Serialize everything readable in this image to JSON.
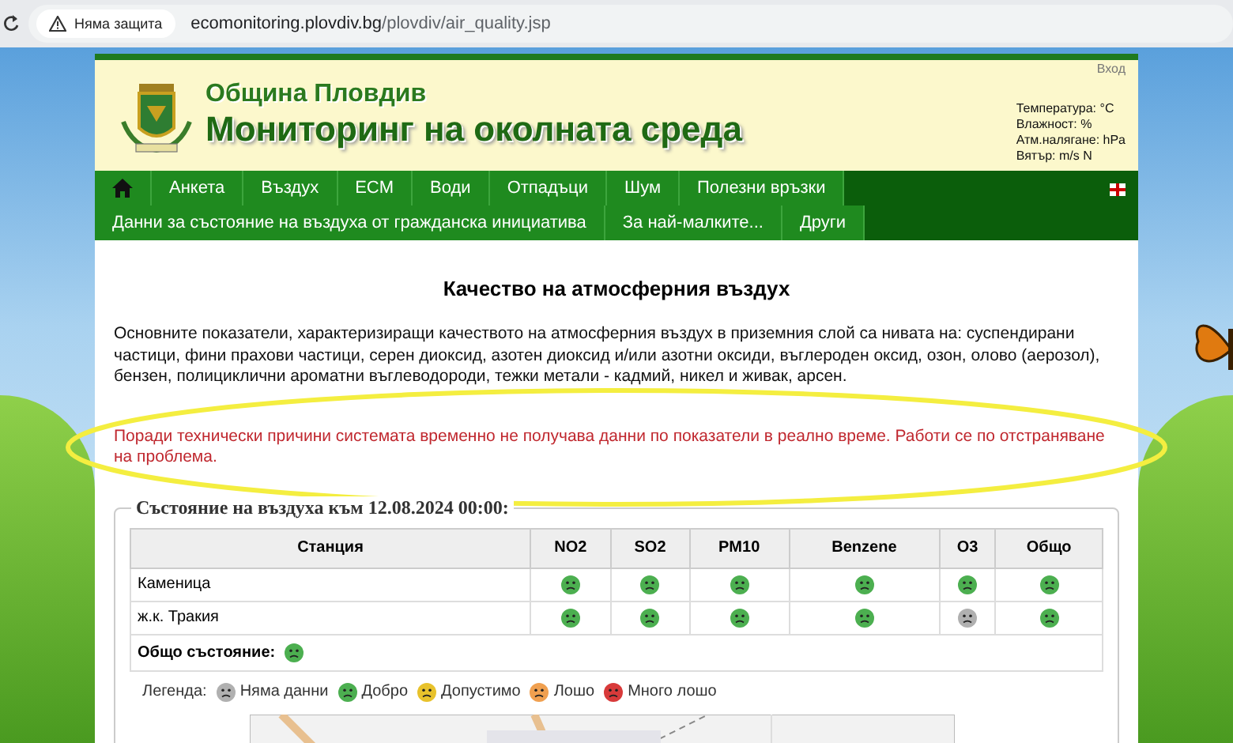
{
  "browser": {
    "security_label": "Няма защита",
    "url_host": "ecomonitoring.plovdiv.bg",
    "url_path": "/plovdiv/air_quality.jsp"
  },
  "header": {
    "login": "Вход",
    "municipality": "Община Пловдив",
    "title": "Мониторинг на околната среда",
    "weather": [
      "Температура: °C",
      "Влажност: %",
      "Атм.налягане: hPa",
      "Вятър: m/s N"
    ]
  },
  "nav": {
    "main": [
      {
        "kind": "home"
      },
      {
        "kind": "link",
        "label": "Анкета"
      },
      {
        "kind": "link",
        "label": "Въздух"
      },
      {
        "kind": "link",
        "label": "ECM"
      },
      {
        "kind": "link",
        "label": "Води"
      },
      {
        "kind": "link",
        "label": "Отпадъци"
      },
      {
        "kind": "link",
        "label": "Шум"
      },
      {
        "kind": "link",
        "label": "Полезни връзки"
      }
    ],
    "secondary": [
      {
        "label": "Данни за състояние на въздуха от гражданска инициатива"
      },
      {
        "label": "За най-малките..."
      },
      {
        "label": "Други"
      }
    ]
  },
  "content": {
    "heading": "Качество на атмосферния въздух",
    "intro": "Основните показатели, характеризиращи качеството на атмосферния въздух в приземния слой са нивата на: суспендирани частици, фини прахови частици, серен диоксид, азотен диоксид и/или азотни оксиди, въглероден оксид, озон, олово (аерозол), бензен, полициклични ароматни въглеводороди, тежки метали - кадмий, никел и живак, арсен.",
    "notice": "Поради технически причини системата временно не получава данни по показатели в реално време. Работи се по отстраняване на проблема.",
    "status_title": "Състояние на въздуха към 12.08.2024 00:00:",
    "table": {
      "columns": [
        "Станция",
        "NO2",
        "SO2",
        "PM10",
        "Benzene",
        "O3",
        "Общо"
      ],
      "rows": [
        {
          "station": "Каменица",
          "cells": [
            {
              "color": "#4caf50"
            },
            {
              "color": "#4caf50"
            },
            {
              "color": "#4caf50"
            },
            {
              "color": "#4caf50"
            },
            {
              "color": "#4caf50"
            },
            {
              "color": "#4caf50"
            }
          ]
        },
        {
          "station": "ж.к. Тракия",
          "cells": [
            {
              "color": "#4caf50"
            },
            {
              "color": "#4caf50"
            },
            {
              "color": "#4caf50"
            },
            {
              "color": "#4caf50"
            },
            {
              "color": "#b0b0b0"
            },
            {
              "color": "#4caf50"
            }
          ]
        }
      ]
    },
    "overall": {
      "label": "Общо състояние:",
      "color": "#4caf50"
    },
    "legend": {
      "label": "Легенда:",
      "items": [
        {
          "color": "#b0b0b0",
          "label": "Няма данни"
        },
        {
          "color": "#4caf50",
          "label": "Добро"
        },
        {
          "color": "#e8c22c",
          "label": "Допустимо"
        },
        {
          "color": "#f0a050",
          "label": "Лошо"
        },
        {
          "color": "#d83a3a",
          "label": "Много лошо"
        }
      ]
    }
  }
}
